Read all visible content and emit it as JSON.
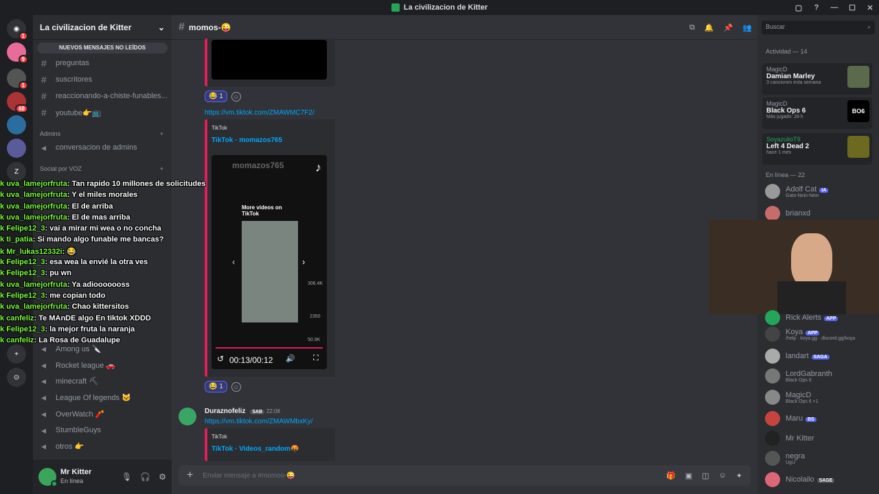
{
  "window": {
    "title": "La civilizacion de Kitter"
  },
  "server": {
    "name": "La civilizacion de Kitter",
    "new_messages": "NUEVOS MENSAJES NO LEÍDOS",
    "channels": [
      "preguntas",
      "suscritores",
      "reaccionando-a-chiste-funables...",
      "youtube👉📺"
    ],
    "cat_admins": "Admins",
    "admin_voice": "conversacion de admins",
    "cat_social": "Social por VOZ",
    "voice": [
      "Among us 🔪",
      "Rocket league 🚗",
      "minecraft ⛏",
      "League Of legends 🐱",
      "OverWatch 🧨",
      "StumbleGuys",
      "otros 👉"
    ]
  },
  "user": {
    "name": "Mr Kitter",
    "status": "En línea"
  },
  "channel": {
    "name": "momos-😜",
    "input_placeholder": "Enviar mensaje a #momos-😜",
    "search_placeholder": "Buscar"
  },
  "messages": {
    "link1": "https://vm.tiktok.com/ZMAWMC7F2/",
    "embed_provider": "TikTok",
    "embed_title": "TikTok · momazos765",
    "video_author": "momazos765",
    "video_more": "More videos on TikTok",
    "video_time": "00:13/00:12",
    "likes": "306.4K",
    "comments": "2350",
    "shares": "50.9K",
    "react_count": "1",
    "author2": "Duraznofeliz",
    "author2_tag": "SAB",
    "author2_time": "22:08",
    "link2": "https://vm.tiktok.com/ZMAWMbxKy/",
    "embed2_provider": "TikTok",
    "embed2_title": "TikTok · Videos_random🤬"
  },
  "activity": {
    "header": "Actividad — 14",
    "items": [
      {
        "who": "MagicD",
        "game": "Damian Marley",
        "sub": "3 canciones esta semana"
      },
      {
        "who": "MagicD",
        "game": "Black Ops 6",
        "sub": "Más jugado: 28 h"
      },
      {
        "who": "SoyazulioT9",
        "game": "Left 4 Dead 2",
        "sub": "hace 1 mes"
      }
    ],
    "online": "En línea — 22"
  },
  "members": [
    {
      "name": "Adolf Cat",
      "tag": "IA",
      "sub": "Gato-Nein-Nein"
    },
    {
      "name": "brianxd",
      "tag": "",
      "sub": ""
    },
    {
      "name": "Rick Alerts",
      "tag": "APP",
      "sub": ""
    },
    {
      "name": "Koya",
      "tag": "APP",
      "sub": "/help · koya.gg · discord.gg/koya"
    },
    {
      "name": "landart",
      "tag": "SAGA",
      "sub": ""
    },
    {
      "name": "LordGabranth",
      "tag": "",
      "sub": "Black Ops 6"
    },
    {
      "name": "MagicD",
      "tag": "",
      "sub": "Black Ops 6 +1"
    },
    {
      "name": "Maru",
      "tag": "BS",
      "sub": ""
    },
    {
      "name": "Mr Kitter",
      "tag": "",
      "sub": ""
    },
    {
      "name": "negra",
      "tag": "",
      "sub": "UgU"
    },
    {
      "name": "Nicolailo",
      "tag": "SAGE",
      "sub": ""
    }
  ],
  "chat": [
    {
      "n": "uva_lamejorfruta",
      "m": "Tan rapido 10 millones de solicitudes"
    },
    {
      "n": "uva_lamejorfruta",
      "m": "Y el miles morales"
    },
    {
      "n": "uva_lamejorfruta",
      "m": "El de arriba"
    },
    {
      "n": "uva_lamejorfruta",
      "m": "El de mas arriba"
    },
    {
      "n": "Felipe12_3",
      "m": "vai a mirar mi wea o no concha"
    },
    {
      "n": "ti_patia",
      "m": "Si mando algo funable me bancas?"
    },
    {
      "n": "Mr_lukas12332i",
      "m": "😂"
    },
    {
      "n": "Felipe12_3",
      "m": "esa wea la envié la otra ves"
    },
    {
      "n": "Felipe12_3",
      "m": "pu wn"
    },
    {
      "n": "uva_lamejorfruta",
      "m": "Ya adiooooooss"
    },
    {
      "n": "Felipe12_3",
      "m": "me copian todo"
    },
    {
      "n": "uva_lamejorfruta",
      "m": "Chao kittersitos"
    },
    {
      "n": "canfeliz",
      "m": "Te MAnDE algo En tiktok XDDD"
    },
    {
      "n": "Felipe12_3",
      "m": "la mejor fruta la naranja"
    },
    {
      "n": "canfeliz",
      "m": "La Rosa de Guadalupe"
    }
  ]
}
